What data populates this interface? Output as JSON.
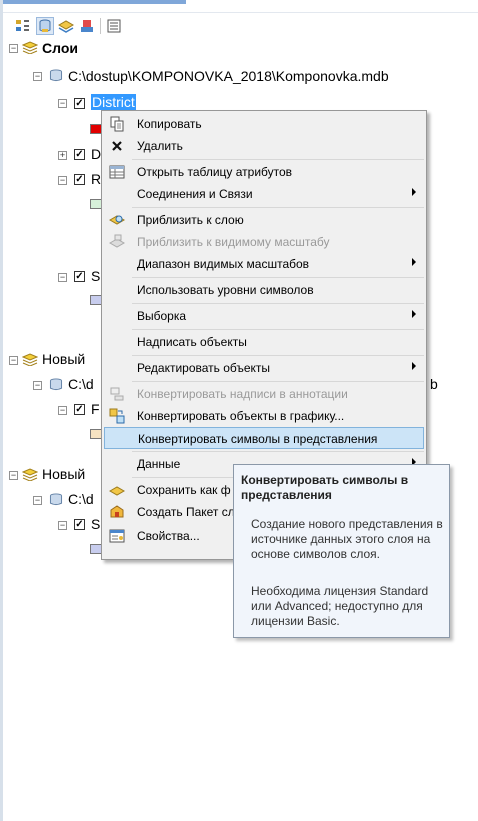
{
  "toolbar": {
    "buttons": [
      "list-by-drawing-order-icon",
      "list-by-source-icon",
      "list-by-visibility-icon",
      "list-by-selection-icon",
      "options-icon"
    ]
  },
  "tree": {
    "group1": {
      "label": "Слои"
    },
    "db1": {
      "label": "C:\\dostup\\KOMPONOVKA_2018\\Komponovka.mdb"
    },
    "district": {
      "label": "District",
      "color": "#e00000"
    },
    "layer2": {
      "label": "D"
    },
    "layer3": {
      "label": "R",
      "color": "#d6f0d9"
    },
    "layer4": {
      "label": "S",
      "color": "#c8cdee"
    },
    "group2": {
      "label": "Новый"
    },
    "db2": {
      "label": "C:\\d",
      "suffix": "b"
    },
    "layer5": {
      "label": "F",
      "color": "#f6e3c2"
    },
    "group3": {
      "label": "Новый"
    },
    "db3": {
      "label": "C:\\d"
    },
    "layer6": {
      "label": "S",
      "color": "#c8cdee"
    }
  },
  "context_menu": {
    "items": [
      {
        "label": "Копировать",
        "icon": "copy-icon"
      },
      {
        "label": "Удалить",
        "icon": "delete-icon"
      },
      {
        "label": "Открыть таблицу атрибутов",
        "icon": "attribute-table-icon"
      },
      {
        "label": "Соединения и Связи",
        "submenu": true
      },
      {
        "label": "Приблизить к слою",
        "icon": "zoom-to-layer-icon"
      },
      {
        "label": "Приблизить к видимому масштабу",
        "icon": "zoom-to-scale-icon",
        "disabled": true
      },
      {
        "label": "Диапазон видимых масштабов",
        "submenu": true
      },
      {
        "label": "Использовать уровни символов"
      },
      {
        "label": "Выборка",
        "submenu": true
      },
      {
        "label": "Надписать объекты"
      },
      {
        "label": "Редактировать объекты",
        "submenu": true
      },
      {
        "label": "Конвертировать надписи в аннотации",
        "icon": "convert-labels-icon",
        "disabled": true
      },
      {
        "label": "Конвертировать объекты в графику...",
        "icon": "convert-features-icon"
      },
      {
        "label": "Конвертировать символы в представления",
        "highlighted": true
      },
      {
        "label": "Данные",
        "submenu": true
      },
      {
        "label": "Сохранить как ф",
        "icon": "save-layer-icon"
      },
      {
        "label": "Создать Пакет сл",
        "icon": "layer-package-icon"
      },
      {
        "label": "Свойства...",
        "icon": "properties-icon"
      }
    ]
  },
  "tooltip": {
    "title": "Конвертировать символы в представления",
    "body": "Создание нового представления в источнике данных этого слоя на основе символов слоя.",
    "license": "Необходима лицензия Standard или Advanced; недоступно для лицензии Basic."
  }
}
